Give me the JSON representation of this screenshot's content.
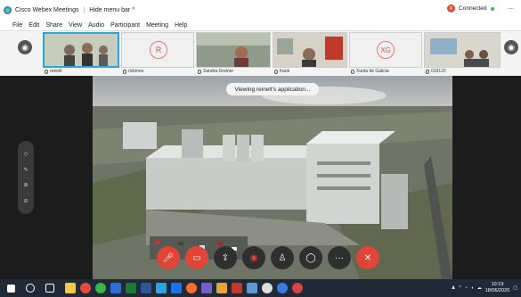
{
  "window": {
    "title": "Cisco Webex Meetings",
    "hide_menu": "Hide menu bar ^",
    "status": "Connected",
    "user_initial": "R"
  },
  "menu": [
    "File",
    "Edit",
    "Share",
    "View",
    "Audio",
    "Participant",
    "Meeting",
    "Help"
  ],
  "participants": [
    {
      "name": "reinelt",
      "initial": ""
    },
    {
      "name": "rickmov",
      "initial": "R"
    },
    {
      "name": "Sandra Greiner",
      "initial": ""
    },
    {
      "name": "frank",
      "initial": ""
    },
    {
      "name": "Xunta de Galicia",
      "initial": "XG"
    },
    {
      "name": "019122",
      "initial": ""
    }
  ],
  "toast": "Viewing reinelt's application...",
  "side_tools": [
    "pin-icon",
    "annotate-icon",
    "zoom-in-icon",
    "zoom-out-icon"
  ],
  "controls": [
    "mute-icon",
    "video-icon",
    "share-icon",
    "record-icon",
    "participants-icon",
    "chat-icon",
    "more-icon",
    "end-icon"
  ],
  "clock": {
    "time": "10:19",
    "date": "18/06/2020"
  },
  "colors": {
    "accent": "#25a7d8",
    "danger": "#e0453a",
    "taskbar": "#1f2a36"
  }
}
